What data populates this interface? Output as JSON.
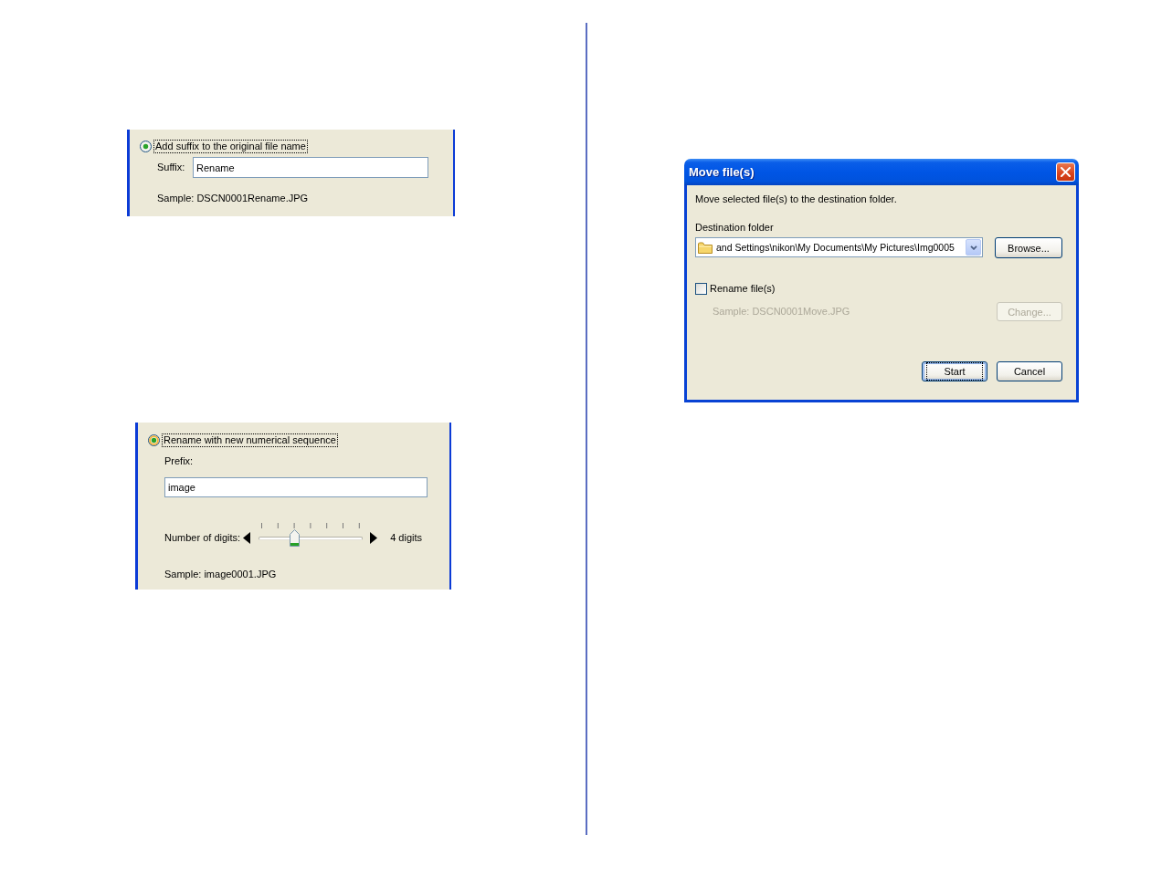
{
  "suffix_panel": {
    "option": {
      "label": "Add suffix to the original file name",
      "selected": true,
      "hovered": false,
      "focused": true
    },
    "suffix": {
      "label": "Suffix:",
      "value": "Rename"
    },
    "sample": "Sample: DSCN0001Rename.JPG"
  },
  "sequence_panel": {
    "option": {
      "label": "Rename with new numerical sequence",
      "selected": true,
      "hovered": true,
      "focused": true
    },
    "prefix": {
      "label": "Prefix:",
      "value": "image"
    },
    "digits": {
      "label": "Number of digits:",
      "level": 0.333,
      "reading": "4 digits"
    },
    "sample": "Sample: image0001.JPG"
  },
  "dialog": {
    "title": "Move file(s)",
    "message": "Move selected file(s) to the destination folder.",
    "destination": {
      "label": "Destination folder",
      "value": "and Settings\\nikon\\My Documents\\My Pictures\\Img0005"
    },
    "browse_button": "Browse...",
    "rename": {
      "label": "Rename file(s)",
      "checked": false
    },
    "sample": {
      "text": "Sample: DSCN0001Move.JPG",
      "disabled": true
    },
    "change_button": {
      "label": "Change...",
      "disabled": true
    },
    "buttons": [
      {
        "label": "Start",
        "default": true
      },
      {
        "label": "Cancel",
        "default": false
      }
    ]
  }
}
